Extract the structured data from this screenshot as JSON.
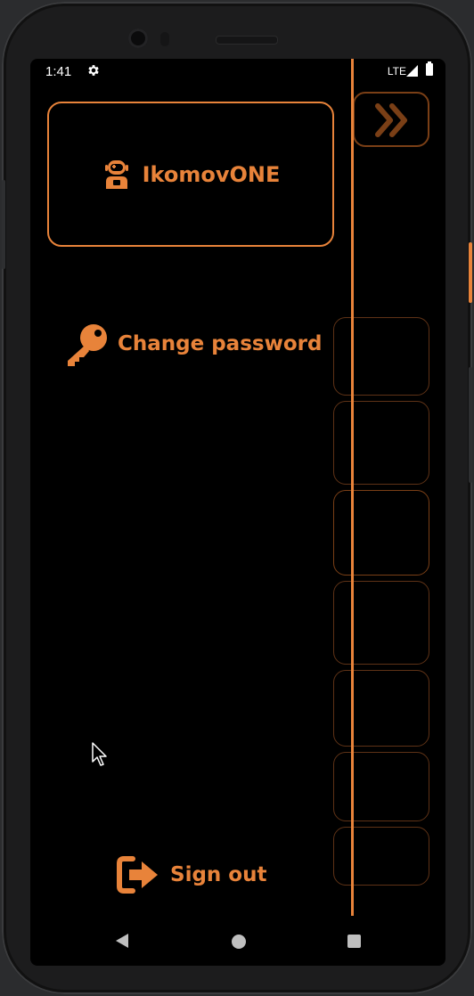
{
  "status_bar": {
    "time": "1:41",
    "network": "LTE",
    "icons": [
      "gear-icon",
      "signal-icon",
      "battery-icon"
    ]
  },
  "drawer": {
    "profile": {
      "username": "IkomovONE",
      "icon": "astronaut-icon"
    },
    "items": [
      {
        "label": "Change password",
        "icon": "key-icon"
      }
    ],
    "footer": {
      "label": "Sign out",
      "icon": "sign-out-icon"
    }
  },
  "background_page": {
    "toggle_icon": "double-chevron-right-icon"
  },
  "nav_bar": {
    "buttons": [
      "back-icon",
      "home-icon",
      "recents-icon"
    ]
  },
  "colors": {
    "accent": "#e8833a",
    "accent_dim": "#7a3f16",
    "background": "#000000",
    "device": "#1c1c1d"
  }
}
